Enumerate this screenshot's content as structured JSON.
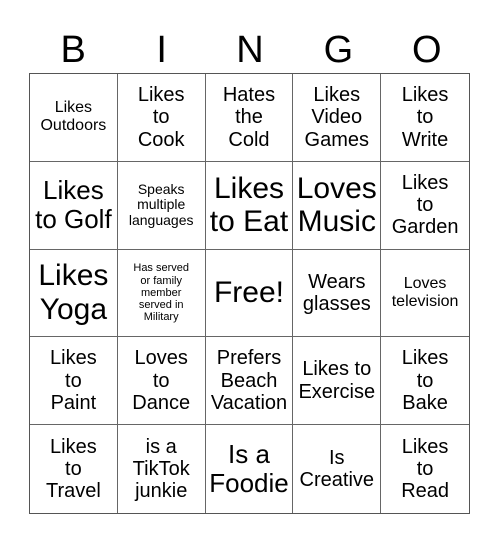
{
  "header": [
    "B",
    "I",
    "N",
    "G",
    "O"
  ],
  "cells": [
    {
      "text": "Likes\nOutdoors",
      "size": "s-md"
    },
    {
      "text": "Likes\nto\nCook",
      "size": "s-lg"
    },
    {
      "text": "Hates\nthe\nCold",
      "size": "s-lg"
    },
    {
      "text": "Likes\nVideo\nGames",
      "size": "s-lg"
    },
    {
      "text": "Likes\nto\nWrite",
      "size": "s-lg"
    },
    {
      "text": "Likes\nto Golf",
      "size": "s-xl"
    },
    {
      "text": "Speaks\nmultiple\nlanguages",
      "size": "s-sm"
    },
    {
      "text": "Likes\nto Eat",
      "size": "s-xxl"
    },
    {
      "text": "Loves\nMusic",
      "size": "s-xxl"
    },
    {
      "text": "Likes\nto\nGarden",
      "size": "s-lg"
    },
    {
      "text": "Likes\nYoga",
      "size": "s-xxl"
    },
    {
      "text": "Has served\nor family\nmember\nserved in\nMilitary",
      "size": "s-xs"
    },
    {
      "text": "Free!",
      "size": "s-xxl"
    },
    {
      "text": "Wears\nglasses",
      "size": "s-lg"
    },
    {
      "text": "Loves\ntelevision",
      "size": "s-md"
    },
    {
      "text": "Likes\nto\nPaint",
      "size": "s-lg"
    },
    {
      "text": "Loves\nto\nDance",
      "size": "s-lg"
    },
    {
      "text": "Prefers\nBeach\nVacation",
      "size": "s-lg"
    },
    {
      "text": "Likes to\nExercise",
      "size": "s-lg"
    },
    {
      "text": "Likes\nto\nBake",
      "size": "s-lg"
    },
    {
      "text": "Likes\nto\nTravel",
      "size": "s-lg"
    },
    {
      "text": "is a\nTikTok\njunkie",
      "size": "s-lg"
    },
    {
      "text": "Is a\nFoodie",
      "size": "s-xl"
    },
    {
      "text": "Is\nCreative",
      "size": "s-lg"
    },
    {
      "text": "Likes\nto\nRead",
      "size": "s-lg"
    }
  ]
}
